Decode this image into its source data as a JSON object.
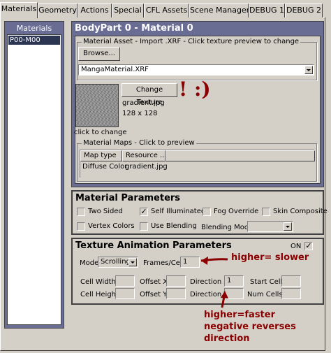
{
  "tabs": [
    "Materials",
    "Geometry",
    "Actions",
    "Special",
    "CFL Assets",
    "Scene Manager",
    "DEBUG 1",
    "DEBUG 2"
  ],
  "left": {
    "title": "Materials",
    "items": [
      "P00-M00"
    ]
  },
  "material": {
    "title": "BodyPart 0 - Material 0",
    "asset_group": "Material Asset - Import .XRF - Click texture preview to change",
    "browse_label": "Browse...",
    "asset_value": "MangaMaterial.XRF",
    "change_texture_label": "Change Texture",
    "texture_name": "gradient.jpg",
    "texture_size": "128 x 128",
    "preview_caption": "click to change",
    "maps_group": "Material Maps - Click to preview",
    "maps_headers": [
      "Map type",
      "Resource ..."
    ],
    "maps_rows": [
      [
        "Diffuse Color",
        "gradient.jpg"
      ]
    ]
  },
  "params": {
    "title": "Material Parameters",
    "two_sided": "Two Sided",
    "self_illuminated": "Self Illuminated",
    "fog_override": "Fog Override",
    "skin_composite": "Skin Composite",
    "vertex_colors": "Vertex Colors",
    "use_blending": "Use Blending",
    "blending_mode_label": "Blending Mode",
    "blending_mode_value": "",
    "self_illuminated_checked": true
  },
  "anim": {
    "title": "Texture Animation Parameters",
    "on_label": "ON",
    "on_checked": true,
    "mode_label": "Mode",
    "mode_value": "Scrolling",
    "frames_label": "Frames/Cell",
    "frames_value": "1",
    "cell_width": "Cell Width",
    "offset_x": "Offset X",
    "direction_x": "Direction X",
    "direction_x_value": "1",
    "start_cell": "Start Cell",
    "cell_height": "Cell Height",
    "offset_y": "Offset Y",
    "direction_y": "Direction Y",
    "num_cells": "Num Cells"
  },
  "annotations": {
    "smiley": "! :)",
    "slower": "higher= slower",
    "faster_1": "higher=faster",
    "faster_2": "negative reverses",
    "faster_3": "direction",
    "color": "#8b0000"
  }
}
